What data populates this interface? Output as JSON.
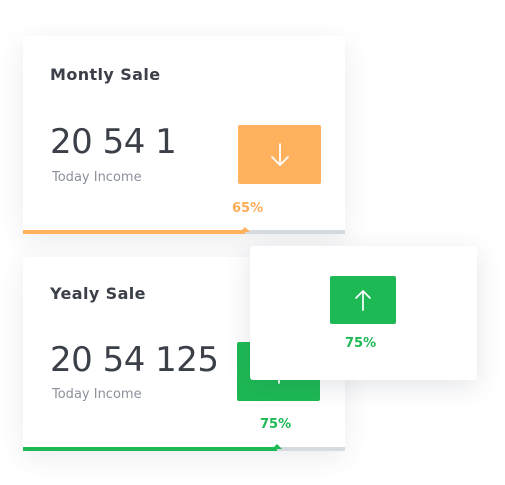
{
  "theme": {
    "orange": "#ffb15e",
    "orange_text": "#ffac57",
    "green": "#1db954",
    "green_text": "#1db954",
    "track": "#d6dbe2"
  },
  "cards": {
    "monthly": {
      "title": "Montly Sale",
      "value": "20 54 1",
      "caption": "Today Income",
      "percent_label": "65%",
      "progress": 0.69,
      "trend_icon": "arrow-down-icon"
    },
    "yearly": {
      "title": "Yealy Sale",
      "value": "20 54 125",
      "caption": "Today Income",
      "percent_label": "75%",
      "progress": 0.79,
      "trend_icon": "arrow-up-icon"
    },
    "mini": {
      "percent_label": "75%",
      "trend_icon": "arrow-up-icon"
    }
  }
}
